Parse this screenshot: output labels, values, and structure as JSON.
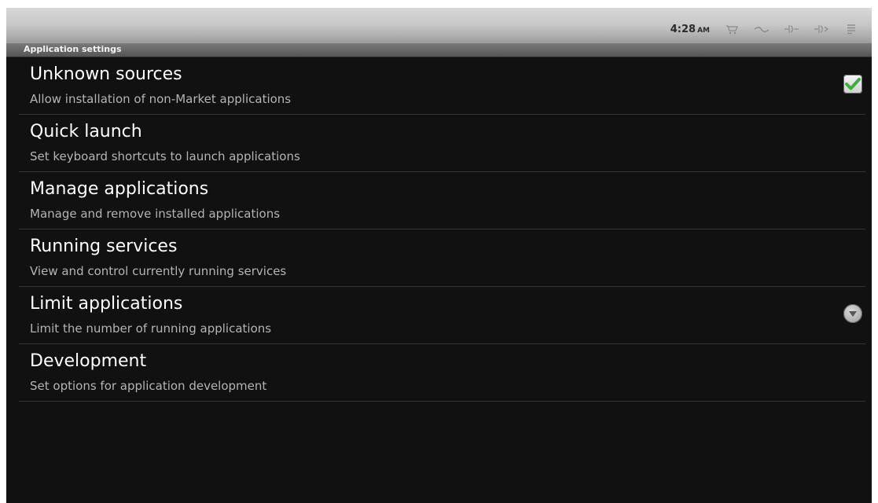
{
  "status_bar": {
    "time": "4:28",
    "ampm": "AM",
    "icons": [
      "market-icon",
      "usb-icon",
      "usb-debug-icon",
      "usb-debug-icon",
      "notification-icon"
    ]
  },
  "header": {
    "title": "Application settings"
  },
  "settings": [
    {
      "title": "Unknown sources",
      "summary": "Allow installation of non-Market applications",
      "widget": "checkbox",
      "checked": true
    },
    {
      "title": "Quick launch",
      "summary": "Set keyboard shortcuts to launch applications",
      "widget": "none"
    },
    {
      "title": "Manage applications",
      "summary": "Manage and remove installed applications",
      "widget": "none"
    },
    {
      "title": "Running services",
      "summary": "View and control currently running services",
      "widget": "none"
    },
    {
      "title": "Limit applications",
      "summary": "Limit the number of running applications",
      "widget": "dropdown"
    },
    {
      "title": "Development",
      "summary": "Set options for application development",
      "widget": "none"
    }
  ],
  "colors": {
    "background": "#111111",
    "title_text": "#ffffff",
    "summary_text": "#b4b4b4",
    "check_green": "#3bb03b",
    "divider": "#333333"
  }
}
